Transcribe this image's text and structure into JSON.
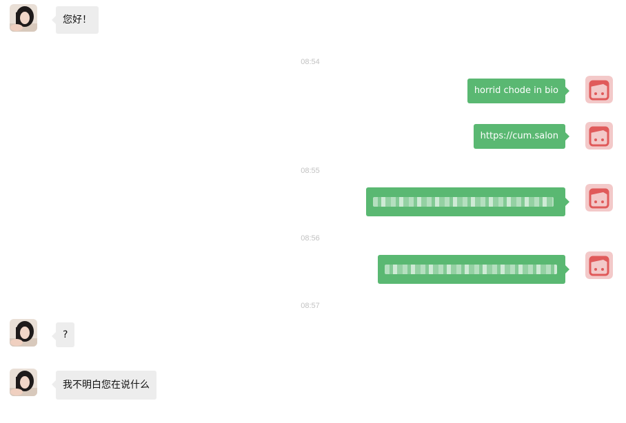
{
  "messages": [
    {
      "side": "left",
      "text": "您好！"
    },
    {
      "timestamp": "08:54"
    },
    {
      "side": "right",
      "text": "horrid chode in bio"
    },
    {
      "side": "right",
      "text": "https://cum.salon"
    },
    {
      "timestamp": "08:55"
    },
    {
      "side": "right",
      "redacted": true
    },
    {
      "timestamp": "08:56"
    },
    {
      "side": "right",
      "redacted": true
    },
    {
      "timestamp": "08:57"
    },
    {
      "side": "left",
      "text": "?"
    },
    {
      "side": "left",
      "text": "我不明白您在说什么"
    }
  ],
  "colors": {
    "outgoing_bubble": "#5ab872",
    "incoming_bubble": "#ededed",
    "timestamp": "#c2c2c2",
    "user_avatar_bg": "#f3c9c9",
    "user_avatar_fg": "#e05a5a"
  },
  "icons": {
    "contact_avatar": "contact-avatar-photo",
    "user_avatar": "red-face-avatar-icon"
  }
}
